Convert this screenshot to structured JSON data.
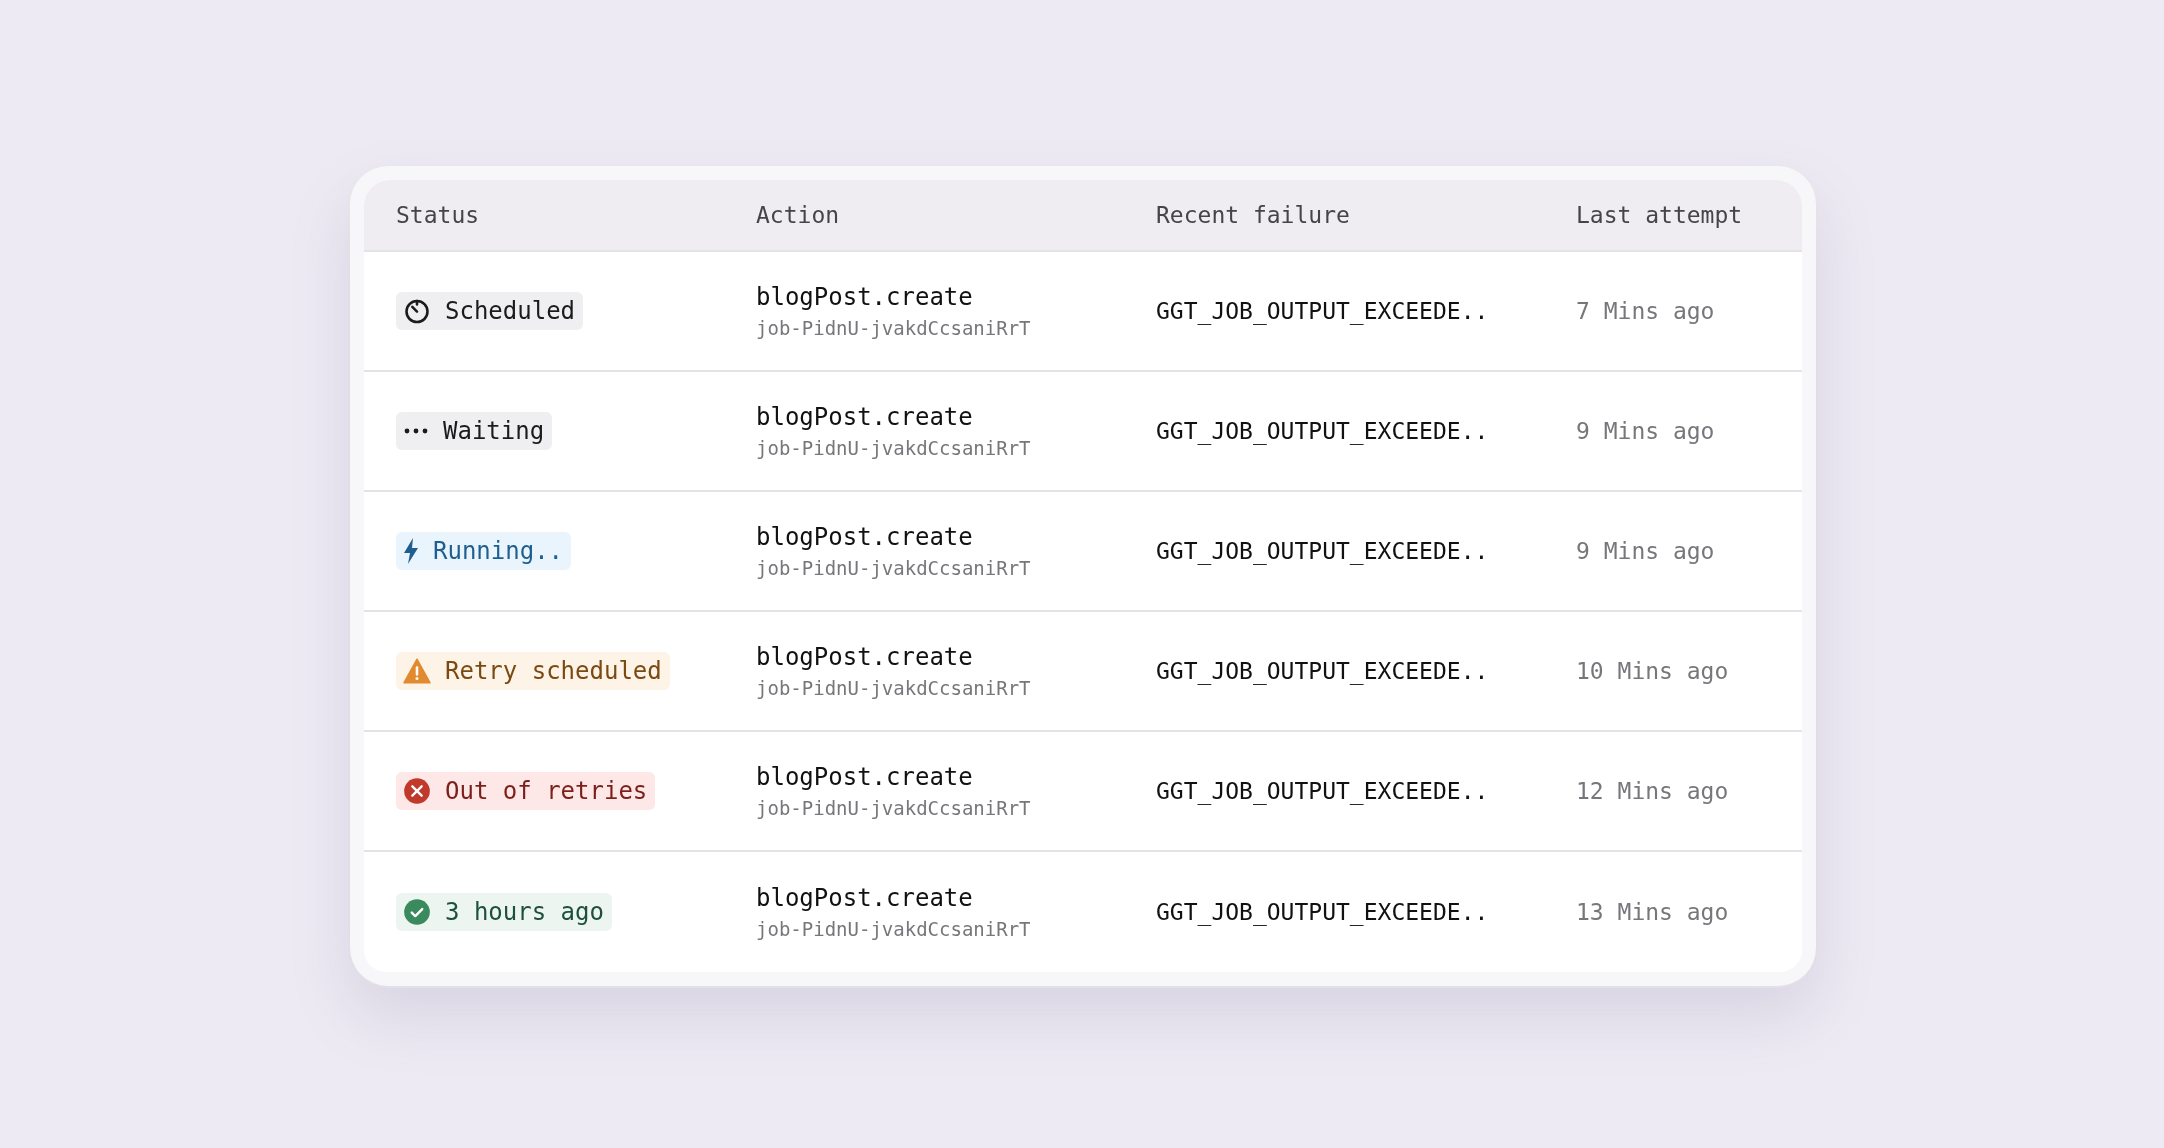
{
  "table": {
    "columns": [
      "Status",
      "Action",
      "Recent failure",
      "Last attempt"
    ],
    "rows": [
      {
        "status": {
          "kind": "scheduled",
          "label": "Scheduled"
        },
        "action": "blogPost.create",
        "job_id": "job-PidnU-jvakdCcsaniRrT",
        "recent_failure": "GGT_JOB_OUTPUT_EXCEEDE..",
        "last_attempt": "7 Mins ago"
      },
      {
        "status": {
          "kind": "waiting",
          "label": "Waiting"
        },
        "action": "blogPost.create",
        "job_id": "job-PidnU-jvakdCcsaniRrT",
        "recent_failure": "GGT_JOB_OUTPUT_EXCEEDE..",
        "last_attempt": "9 Mins ago"
      },
      {
        "status": {
          "kind": "running",
          "label": "Running.."
        },
        "action": "blogPost.create",
        "job_id": "job-PidnU-jvakdCcsaniRrT",
        "recent_failure": "GGT_JOB_OUTPUT_EXCEEDE..",
        "last_attempt": "9 Mins ago"
      },
      {
        "status": {
          "kind": "retry",
          "label": "Retry scheduled"
        },
        "action": "blogPost.create",
        "job_id": "job-PidnU-jvakdCcsaniRrT",
        "recent_failure": "GGT_JOB_OUTPUT_EXCEEDE..",
        "last_attempt": "10 Mins ago"
      },
      {
        "status": {
          "kind": "failed",
          "label": "Out of retries"
        },
        "action": "blogPost.create",
        "job_id": "job-PidnU-jvakdCcsaniRrT",
        "recent_failure": "GGT_JOB_OUTPUT_EXCEEDE..",
        "last_attempt": "12 Mins ago"
      },
      {
        "status": {
          "kind": "success",
          "label": "3 hours ago"
        },
        "action": "blogPost.create",
        "job_id": "job-PidnU-jvakdCcsaniRrT",
        "recent_failure": "GGT_JOB_OUTPUT_EXCEEDE..",
        "last_attempt": "13 Mins ago"
      }
    ]
  }
}
